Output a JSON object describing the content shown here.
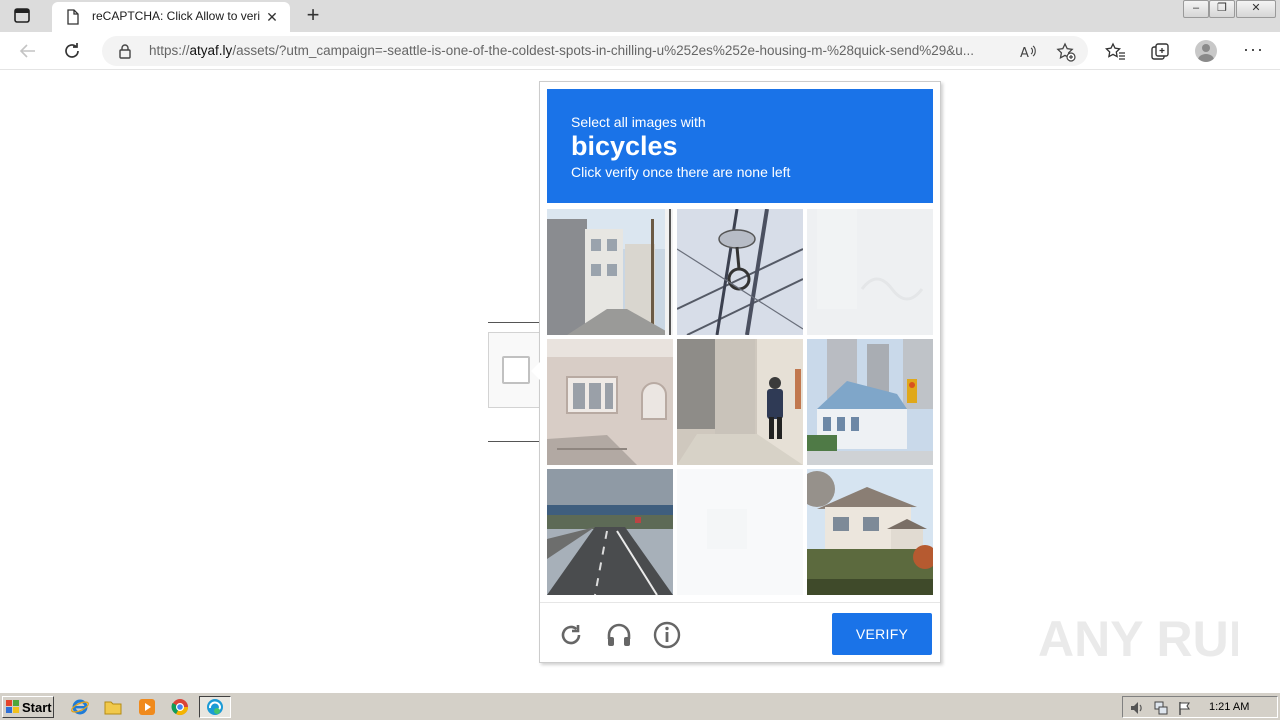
{
  "browser": {
    "tab_title": "reCAPTCHA: Click Allow to verify",
    "url_prefix": "https://",
    "url_host": "atyaf.ly",
    "url_rest": "/assets/?utm_campaign=-seattle-is-one-of-the-coldest-spots-in-chilling-u%252es%252e-housing-m-%28quick-send%29&u..."
  },
  "captcha": {
    "line1": "Select all images with",
    "keyword": "bicycles",
    "line3": "Click verify once there are none left",
    "verify_label": "VERIFY",
    "tiles": [
      {
        "id": "tile-1",
        "desc": "street-houses"
      },
      {
        "id": "tile-2",
        "desc": "streetlamp-wires"
      },
      {
        "id": "tile-3",
        "desc": "faded-blank"
      },
      {
        "id": "tile-4",
        "desc": "house-facade"
      },
      {
        "id": "tile-5",
        "desc": "pedestrian-alley"
      },
      {
        "id": "tile-6",
        "desc": "towers-traffic-light"
      },
      {
        "id": "tile-7",
        "desc": "highway-overpass"
      },
      {
        "id": "tile-8",
        "desc": "faded-blank"
      },
      {
        "id": "tile-9",
        "desc": "suburban-house"
      }
    ]
  },
  "watermark": {
    "text": "ANY RUN"
  },
  "taskbar": {
    "start_label": "Start",
    "clock": "1:21 AM"
  },
  "colors": {
    "captcha_blue": "#1a73e8",
    "taskbar": "#d4d0c8"
  }
}
